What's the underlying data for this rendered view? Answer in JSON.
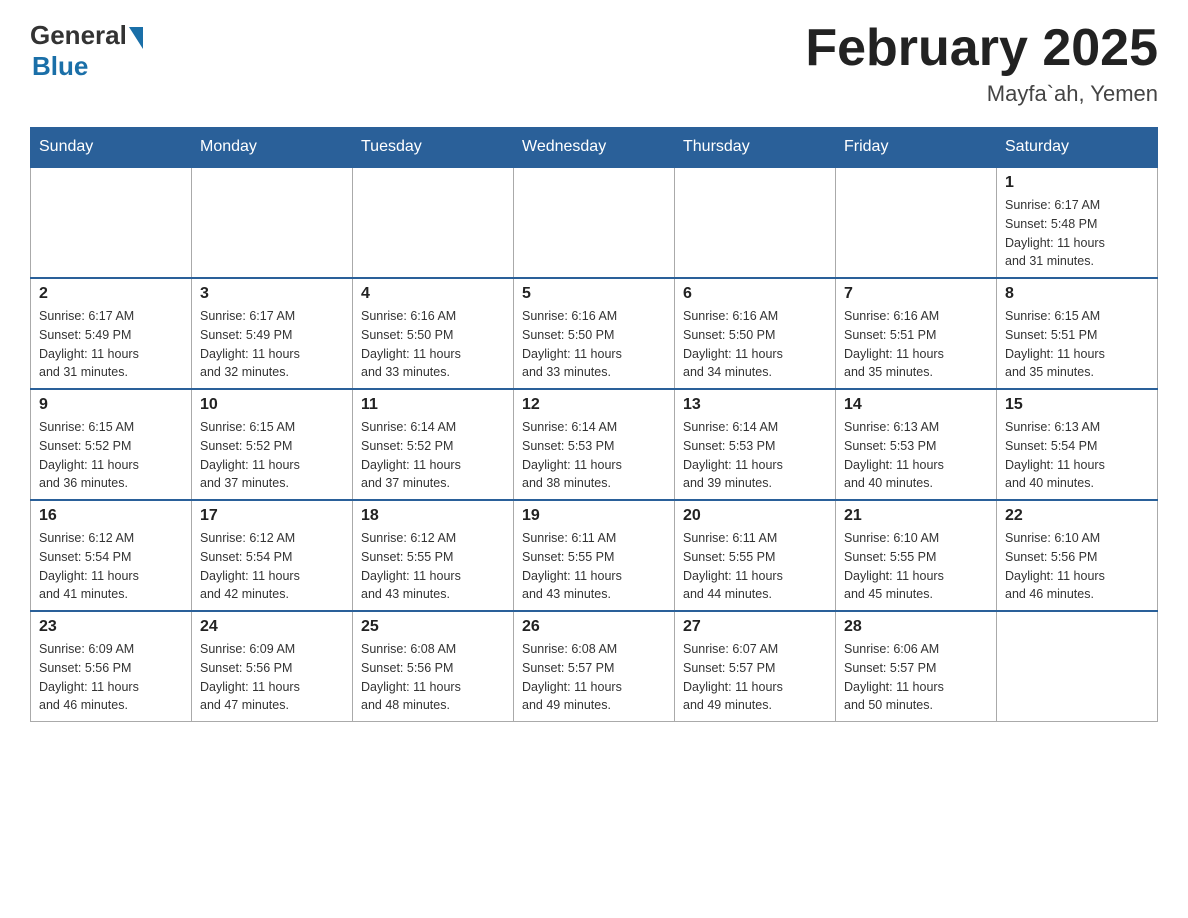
{
  "header": {
    "logo_general": "General",
    "logo_blue": "Blue",
    "title": "February 2025",
    "location": "Mayfa`ah, Yemen"
  },
  "weekdays": [
    "Sunday",
    "Monday",
    "Tuesday",
    "Wednesday",
    "Thursday",
    "Friday",
    "Saturday"
  ],
  "weeks": [
    [
      {
        "day": "",
        "info": ""
      },
      {
        "day": "",
        "info": ""
      },
      {
        "day": "",
        "info": ""
      },
      {
        "day": "",
        "info": ""
      },
      {
        "day": "",
        "info": ""
      },
      {
        "day": "",
        "info": ""
      },
      {
        "day": "1",
        "info": "Sunrise: 6:17 AM\nSunset: 5:48 PM\nDaylight: 11 hours\nand 31 minutes."
      }
    ],
    [
      {
        "day": "2",
        "info": "Sunrise: 6:17 AM\nSunset: 5:49 PM\nDaylight: 11 hours\nand 31 minutes."
      },
      {
        "day": "3",
        "info": "Sunrise: 6:17 AM\nSunset: 5:49 PM\nDaylight: 11 hours\nand 32 minutes."
      },
      {
        "day": "4",
        "info": "Sunrise: 6:16 AM\nSunset: 5:50 PM\nDaylight: 11 hours\nand 33 minutes."
      },
      {
        "day": "5",
        "info": "Sunrise: 6:16 AM\nSunset: 5:50 PM\nDaylight: 11 hours\nand 33 minutes."
      },
      {
        "day": "6",
        "info": "Sunrise: 6:16 AM\nSunset: 5:50 PM\nDaylight: 11 hours\nand 34 minutes."
      },
      {
        "day": "7",
        "info": "Sunrise: 6:16 AM\nSunset: 5:51 PM\nDaylight: 11 hours\nand 35 minutes."
      },
      {
        "day": "8",
        "info": "Sunrise: 6:15 AM\nSunset: 5:51 PM\nDaylight: 11 hours\nand 35 minutes."
      }
    ],
    [
      {
        "day": "9",
        "info": "Sunrise: 6:15 AM\nSunset: 5:52 PM\nDaylight: 11 hours\nand 36 minutes."
      },
      {
        "day": "10",
        "info": "Sunrise: 6:15 AM\nSunset: 5:52 PM\nDaylight: 11 hours\nand 37 minutes."
      },
      {
        "day": "11",
        "info": "Sunrise: 6:14 AM\nSunset: 5:52 PM\nDaylight: 11 hours\nand 37 minutes."
      },
      {
        "day": "12",
        "info": "Sunrise: 6:14 AM\nSunset: 5:53 PM\nDaylight: 11 hours\nand 38 minutes."
      },
      {
        "day": "13",
        "info": "Sunrise: 6:14 AM\nSunset: 5:53 PM\nDaylight: 11 hours\nand 39 minutes."
      },
      {
        "day": "14",
        "info": "Sunrise: 6:13 AM\nSunset: 5:53 PM\nDaylight: 11 hours\nand 40 minutes."
      },
      {
        "day": "15",
        "info": "Sunrise: 6:13 AM\nSunset: 5:54 PM\nDaylight: 11 hours\nand 40 minutes."
      }
    ],
    [
      {
        "day": "16",
        "info": "Sunrise: 6:12 AM\nSunset: 5:54 PM\nDaylight: 11 hours\nand 41 minutes."
      },
      {
        "day": "17",
        "info": "Sunrise: 6:12 AM\nSunset: 5:54 PM\nDaylight: 11 hours\nand 42 minutes."
      },
      {
        "day": "18",
        "info": "Sunrise: 6:12 AM\nSunset: 5:55 PM\nDaylight: 11 hours\nand 43 minutes."
      },
      {
        "day": "19",
        "info": "Sunrise: 6:11 AM\nSunset: 5:55 PM\nDaylight: 11 hours\nand 43 minutes."
      },
      {
        "day": "20",
        "info": "Sunrise: 6:11 AM\nSunset: 5:55 PM\nDaylight: 11 hours\nand 44 minutes."
      },
      {
        "day": "21",
        "info": "Sunrise: 6:10 AM\nSunset: 5:55 PM\nDaylight: 11 hours\nand 45 minutes."
      },
      {
        "day": "22",
        "info": "Sunrise: 6:10 AM\nSunset: 5:56 PM\nDaylight: 11 hours\nand 46 minutes."
      }
    ],
    [
      {
        "day": "23",
        "info": "Sunrise: 6:09 AM\nSunset: 5:56 PM\nDaylight: 11 hours\nand 46 minutes."
      },
      {
        "day": "24",
        "info": "Sunrise: 6:09 AM\nSunset: 5:56 PM\nDaylight: 11 hours\nand 47 minutes."
      },
      {
        "day": "25",
        "info": "Sunrise: 6:08 AM\nSunset: 5:56 PM\nDaylight: 11 hours\nand 48 minutes."
      },
      {
        "day": "26",
        "info": "Sunrise: 6:08 AM\nSunset: 5:57 PM\nDaylight: 11 hours\nand 49 minutes."
      },
      {
        "day": "27",
        "info": "Sunrise: 6:07 AM\nSunset: 5:57 PM\nDaylight: 11 hours\nand 49 minutes."
      },
      {
        "day": "28",
        "info": "Sunrise: 6:06 AM\nSunset: 5:57 PM\nDaylight: 11 hours\nand 50 minutes."
      },
      {
        "day": "",
        "info": ""
      }
    ]
  ]
}
